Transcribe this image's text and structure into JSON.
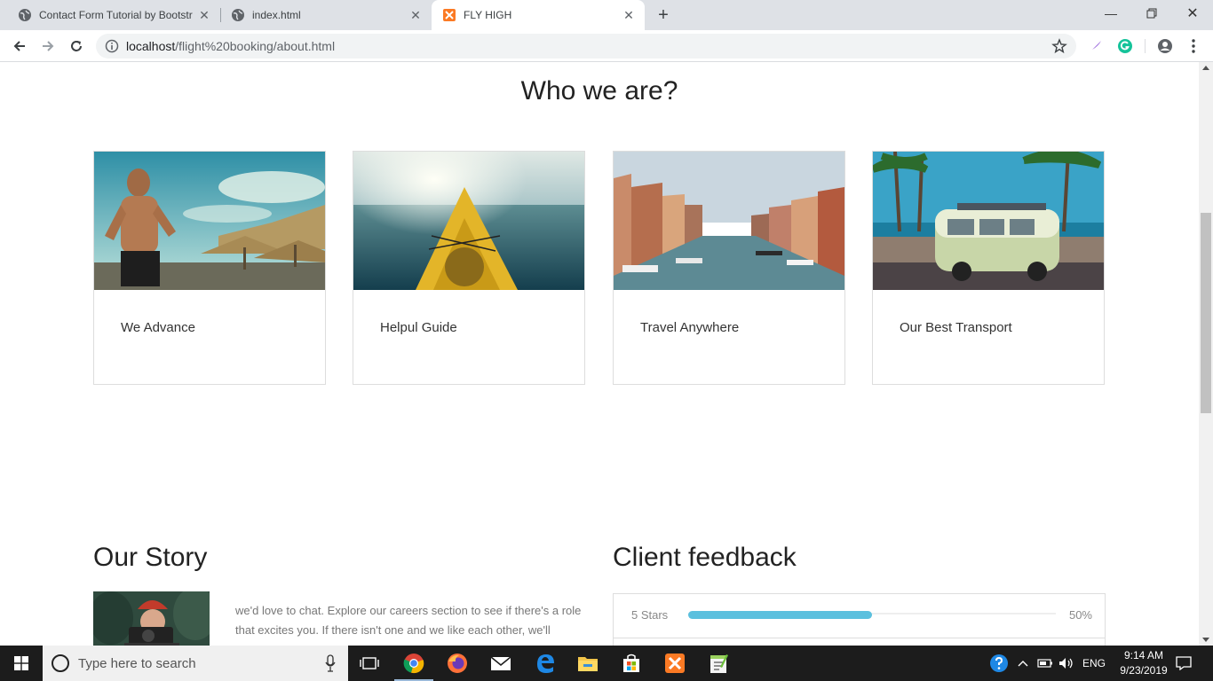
{
  "browser": {
    "tabs": [
      {
        "title": "Contact Form Tutorial by Bootstr",
        "icon": "globe-icon",
        "active": false
      },
      {
        "title": "index.html",
        "icon": "globe-icon",
        "active": false
      },
      {
        "title": "FLY HIGH",
        "icon": "xampp-icon",
        "active": true
      }
    ],
    "url_host": "localhost",
    "url_path": "/flight%20booking/about.html"
  },
  "page": {
    "section_title": "Who we are?",
    "cards": [
      {
        "label": "We Advance",
        "image": "beach-man-photo"
      },
      {
        "label": "Helpul Guide",
        "image": "kayak-photo"
      },
      {
        "label": "Travel Anywhere",
        "image": "venice-canal-photo"
      },
      {
        "label": "Our Best Transport",
        "image": "camper-van-photo"
      }
    ],
    "story": {
      "title": "Our Story",
      "text": "we'd love to chat. Explore our careers section to see if there's a role that excites you. If there isn't one and we like each other, we'll"
    },
    "feedback": {
      "title": "Client feedback",
      "rows": [
        {
          "label": "5 Stars",
          "value": 0.5,
          "percent_label": "50%"
        }
      ],
      "accent": "#5bc0de"
    }
  },
  "taskbar": {
    "search_placeholder": "Type here to search",
    "language": "ENG",
    "time": "9:14 AM",
    "date": "9/23/2019"
  }
}
